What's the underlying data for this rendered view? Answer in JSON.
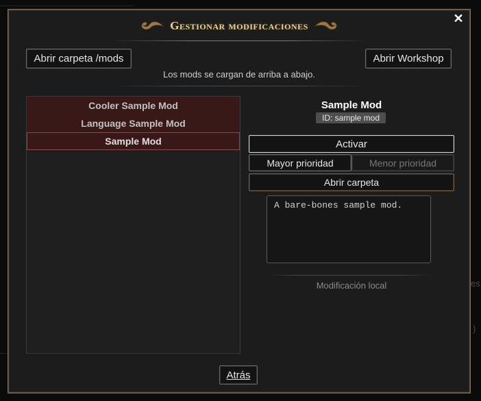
{
  "dialog": {
    "title": "Gestionar modificaciones",
    "close_glyph": "✕"
  },
  "toolbar": {
    "open_mods_folder": "Abrir carpeta /mods",
    "open_workshop": "Abrir Workshop"
  },
  "hint": "Los mods se cargan de arriba a abajo.",
  "mods": [
    {
      "name": "Cooler Sample Mod",
      "selected": false
    },
    {
      "name": "Language Sample Mod",
      "selected": false
    },
    {
      "name": "Sample Mod",
      "selected": true
    }
  ],
  "detail": {
    "title": "Sample Mod",
    "id": "ID: sample mod",
    "activate": "Activar",
    "priority_up": "Mayor prioridad",
    "priority_down": "Menor prioridad",
    "open_folder": "Abrir carpeta",
    "description": "A bare-bones sample mod.",
    "source": "Modificación local"
  },
  "footer": {
    "back": "Atrás"
  },
  "background_peek": {
    "right_fragment_1": "es",
    "right_fragment_2": ")"
  },
  "colors": {
    "accent_gold": "#e9d6a4",
    "mod_row_bg": "#3a1818",
    "dialog_bg": "#1c1c1c"
  }
}
